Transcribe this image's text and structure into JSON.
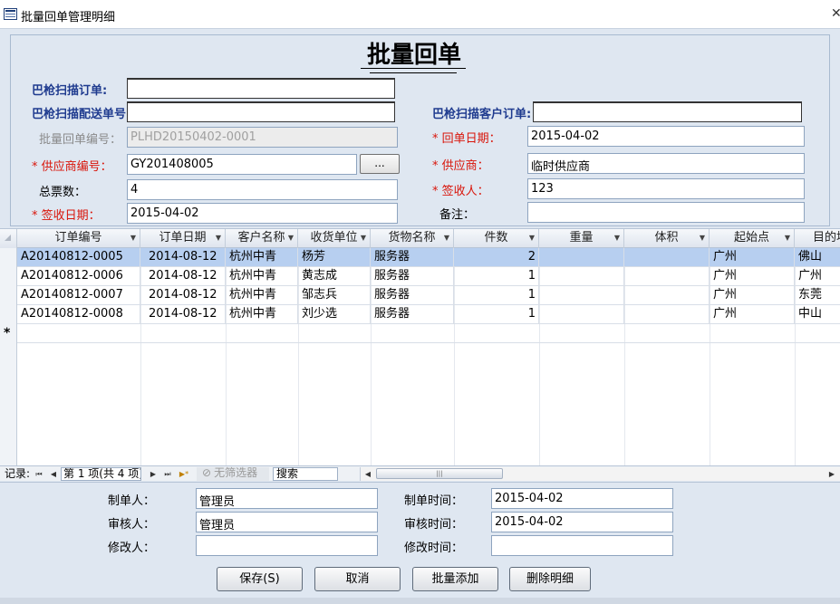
{
  "window": {
    "title": "批量回单管理明细",
    "close": "✕"
  },
  "form": {
    "title": "批量回单"
  },
  "scan": {
    "order_label": "巴枪扫描订单:",
    "delivery_label": "巴枪扫描配送单号",
    "customer_order_label": "巴枪扫描客户订单:",
    "order_value": "",
    "delivery_value": "",
    "customer_order_value": ""
  },
  "fields": {
    "batch_no_label": "批量回单编号：",
    "batch_no": "PLHD20150402-0001",
    "return_date_label": "* 回单日期：",
    "return_date": "2015-04-02",
    "supplier_code_label": "* 供应商编号：",
    "supplier_code": "GY201408005",
    "lookup_label": "...",
    "supplier_label": "* 供应商：",
    "supplier": "临时供应商",
    "total_label": "总票数：",
    "total": "4",
    "receiver_label": "* 签收人：",
    "receiver": "123",
    "sign_date_label": "* 签收日期：",
    "sign_date": "2015-04-02",
    "remark_label": "备注：",
    "remark": ""
  },
  "grid": {
    "columns": [
      "订单编号",
      "订单日期",
      "客户名称",
      "收货单位",
      "货物名称",
      "件数",
      "重量",
      "体积",
      "起始点",
      "目的地"
    ],
    "rows": [
      [
        "A20140812-0005",
        "2014-08-12",
        "杭州中青",
        "杨芳",
        "服务器",
        "2",
        "",
        "",
        "广州",
        "佛山"
      ],
      [
        "A20140812-0006",
        "2014-08-12",
        "杭州中青",
        "黄志成",
        "服务器",
        "1",
        "",
        "",
        "广州",
        "广州"
      ],
      [
        "A20140812-0007",
        "2014-08-12",
        "杭州中青",
        "邹志兵",
        "服务器",
        "1",
        "",
        "",
        "广州",
        "东莞"
      ],
      [
        "A20140812-0008",
        "2014-08-12",
        "杭州中青",
        "刘少选",
        "服务器",
        "1",
        "",
        "",
        "广州",
        "中山"
      ]
    ],
    "new_row_marker": "*"
  },
  "nav": {
    "label": "记录:",
    "position": "第 1 项(共 4 项)",
    "no_filter": "无筛选器",
    "search": "搜索",
    "first": "⏮",
    "prev": "◀",
    "next": "▶",
    "last": "⏭",
    "new": "▶*",
    "scroll_left": "◀",
    "scroll_right": "▶"
  },
  "audit": {
    "maker_label": "制单人：",
    "maker": "管理员",
    "make_time_label": "制单时间：",
    "make_time": "2015-04-02",
    "auditor_label": "审核人：",
    "auditor": "管理员",
    "audit_time_label": "审核时间：",
    "audit_time": "2015-04-02",
    "modifier_label": "修改人：",
    "modifier": "",
    "modify_time_label": "修改时间：",
    "modify_time": ""
  },
  "buttons": {
    "save": "保存(S)",
    "cancel": "取消",
    "batch_add": "批量添加",
    "delete_detail": "删除明细"
  },
  "colors": {
    "label_blue": "#1f3b8f",
    "required_red": "#d9150a",
    "selected_row": "#b7cff0",
    "panel_bg": "#dfe7f1"
  }
}
